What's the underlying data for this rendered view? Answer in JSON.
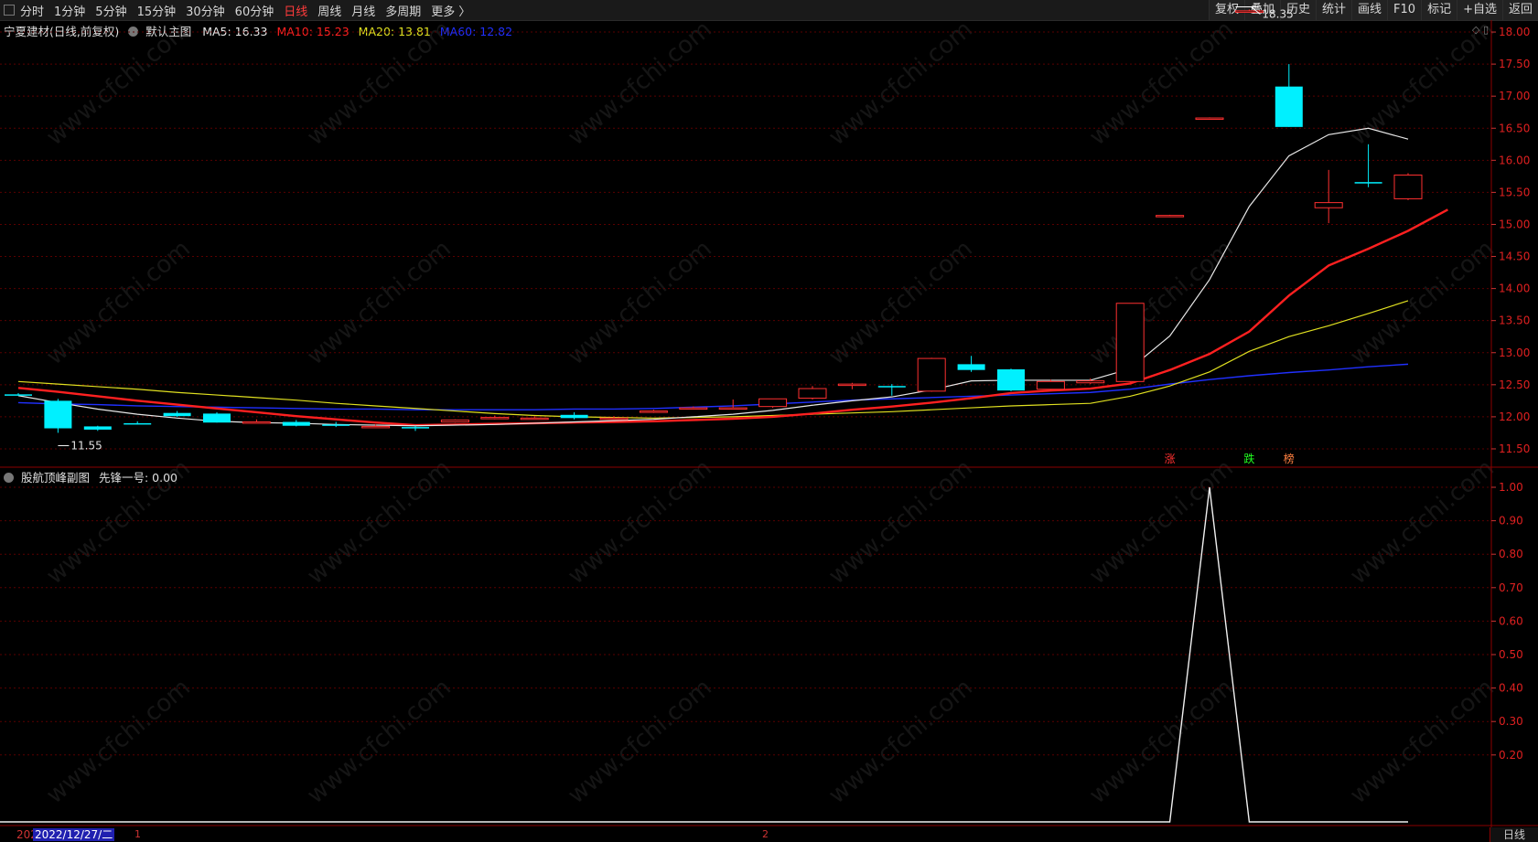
{
  "toolbar": {
    "periods": [
      "分时",
      "1分钟",
      "5分钟",
      "15分钟",
      "30分钟",
      "60分钟",
      "日线",
      "周线",
      "月线",
      "多周期",
      "更多 〉"
    ],
    "active_period": "日线",
    "actions": [
      "复权",
      "叠加",
      "历史",
      "统计",
      "画线",
      "F10",
      "标记",
      "+自选",
      "返回"
    ]
  },
  "main_info": {
    "stock": "宁夏建材(日线,前复权)",
    "template": "默认主图",
    "ma5": "MA5: 16.33",
    "ma10": "MA10: 15.23",
    "ma20": "MA20: 13.81",
    "ma60": "MA60: 12.82"
  },
  "sub_info": {
    "indicator": "股航顶峰副图",
    "value": "先锋一号: 0.00"
  },
  "colors": {
    "ma5": "#e8e8e8",
    "ma10": "#ff2020",
    "ma20": "#e0e020",
    "ma60": "#2030ff",
    "up": "#ff3030",
    "down": "#00f0ff"
  },
  "footer": {
    "date_prefix": "202",
    "date": "2022/12/27/二",
    "x_label_1": "1",
    "x_label_2": "2",
    "period_label": "日线"
  },
  "annotations": {
    "high": "18.35",
    "low": "11.55"
  },
  "signals": [
    {
      "index": 29,
      "text": "涨",
      "color": "#ff3030"
    },
    {
      "index": 31,
      "text": "跌",
      "color": "#20ff20"
    },
    {
      "index": 32,
      "text": "榜",
      "color": "#ff8040"
    }
  ],
  "watermark": "www.cfchi.com",
  "chart_data": [
    {
      "type": "candlestick",
      "ylim": [
        11.3,
        18.3
      ],
      "ticks": [
        "18.00",
        "17.50",
        "17.00",
        "16.50",
        "16.00",
        "15.50",
        "15.00",
        "14.50",
        "14.00",
        "13.50",
        "13.00",
        "12.50",
        "12.00",
        "11.50"
      ],
      "candles": [
        [
          12.35,
          12.37,
          12.33,
          12.34
        ],
        [
          12.25,
          12.28,
          11.75,
          11.82
        ],
        [
          11.85,
          11.86,
          11.78,
          11.8
        ],
        [
          11.9,
          11.93,
          11.88,
          11.88
        ],
        [
          12.06,
          12.09,
          12.0,
          12.01
        ],
        [
          12.05,
          12.07,
          11.91,
          11.91
        ],
        [
          11.92,
          11.96,
          11.9,
          11.92
        ],
        [
          11.92,
          11.95,
          11.85,
          11.86
        ],
        [
          11.88,
          11.92,
          11.84,
          11.86
        ],
        [
          11.85,
          11.88,
          11.83,
          11.85
        ],
        [
          11.84,
          11.86,
          11.78,
          11.83
        ],
        [
          11.92,
          11.96,
          11.91,
          11.95
        ],
        [
          11.98,
          12.02,
          11.96,
          11.99
        ],
        [
          11.98,
          12.01,
          11.96,
          11.98
        ],
        [
          12.03,
          12.07,
          11.96,
          11.98
        ],
        [
          11.98,
          12.01,
          11.96,
          11.98
        ],
        [
          12.08,
          12.11,
          12.06,
          12.09
        ],
        [
          12.14,
          12.16,
          12.12,
          12.14
        ],
        [
          12.14,
          12.27,
          12.12,
          12.14
        ],
        [
          12.16,
          12.28,
          12.14,
          12.28
        ],
        [
          12.29,
          12.48,
          12.27,
          12.44
        ],
        [
          12.49,
          12.53,
          12.43,
          12.51
        ],
        [
          12.48,
          12.51,
          12.33,
          12.47
        ],
        [
          12.4,
          12.92,
          12.39,
          12.91
        ],
        [
          12.82,
          12.95,
          12.7,
          12.73
        ],
        [
          12.74,
          12.75,
          12.4,
          12.41
        ],
        [
          12.43,
          12.58,
          12.41,
          12.55
        ],
        [
          12.53,
          12.6,
          12.51,
          12.56
        ],
        [
          12.55,
          13.77,
          12.54,
          13.77
        ],
        [
          15.14,
          15.15,
          15.13,
          15.14
        ],
        [
          16.66,
          16.67,
          16.66,
          16.66
        ],
        [
          18.33,
          18.35,
          18.31,
          18.33
        ],
        [
          17.15,
          17.5,
          16.52,
          16.52
        ],
        [
          15.26,
          15.85,
          15.02,
          15.34
        ],
        [
          15.66,
          16.25,
          15.58,
          15.64
        ],
        [
          15.4,
          15.8,
          15.38,
          15.77
        ]
      ],
      "series": [
        {
          "name": "MA5",
          "values": [
            12.33,
            12.22,
            12.12,
            12.04,
            11.98,
            11.93,
            11.91,
            11.9,
            11.88,
            11.87,
            11.86,
            11.87,
            11.88,
            11.9,
            11.92,
            11.94,
            11.96,
            12.0,
            12.04,
            12.1,
            12.18,
            12.25,
            12.31,
            12.42,
            12.56,
            12.57,
            12.57,
            12.57,
            12.75,
            13.26,
            14.14,
            15.28,
            16.07,
            16.4,
            16.5,
            16.33
          ]
        },
        {
          "name": "MA10",
          "values": [
            12.45,
            12.39,
            12.32,
            12.25,
            12.19,
            12.13,
            12.07,
            12.01,
            11.96,
            11.91,
            11.87,
            11.88,
            11.89,
            11.9,
            11.91,
            11.92,
            11.93,
            11.95,
            11.97,
            12.0,
            12.05,
            12.11,
            12.16,
            12.22,
            12.29,
            12.37,
            12.41,
            12.44,
            12.52,
            12.73,
            12.98,
            13.33,
            13.89,
            14.36,
            14.62,
            14.9,
            15.23
          ]
        },
        {
          "name": "MA20",
          "values": [
            12.55,
            12.51,
            12.47,
            12.43,
            12.38,
            12.34,
            12.3,
            12.26,
            12.21,
            12.17,
            12.13,
            12.09,
            12.05,
            12.02,
            12.0,
            11.99,
            11.98,
            11.99,
            12.0,
            12.02,
            12.04,
            12.06,
            12.08,
            12.11,
            12.14,
            12.17,
            12.19,
            12.21,
            12.32,
            12.48,
            12.7,
            13.02,
            13.25,
            13.42,
            13.61,
            13.81
          ]
        },
        {
          "name": "MA60",
          "values": [
            12.22,
            12.2,
            12.19,
            12.17,
            12.16,
            12.15,
            12.14,
            12.13,
            12.12,
            12.12,
            12.11,
            12.11,
            12.11,
            12.11,
            12.12,
            12.12,
            12.13,
            12.15,
            12.17,
            12.2,
            12.23,
            12.26,
            12.28,
            12.3,
            12.32,
            12.34,
            12.36,
            12.38,
            12.43,
            12.51,
            12.58,
            12.64,
            12.69,
            12.73,
            12.78,
            12.82
          ]
        }
      ]
    },
    {
      "type": "line",
      "ylim": [
        0,
        1.05
      ],
      "ticks": [
        "1.00",
        "0.90",
        "0.80",
        "0.70",
        "0.60",
        "0.50",
        "0.40",
        "0.30",
        "0.20"
      ],
      "series": [
        {
          "name": "先锋一号",
          "values": [
            0,
            0,
            0,
            0,
            0,
            0,
            0,
            0,
            0,
            0,
            0,
            0,
            0,
            0,
            0,
            0,
            0,
            0,
            0,
            0,
            0,
            0,
            0,
            0,
            0,
            0,
            0,
            0,
            0,
            0,
            1,
            0,
            0,
            0,
            0,
            0
          ]
        }
      ]
    }
  ]
}
